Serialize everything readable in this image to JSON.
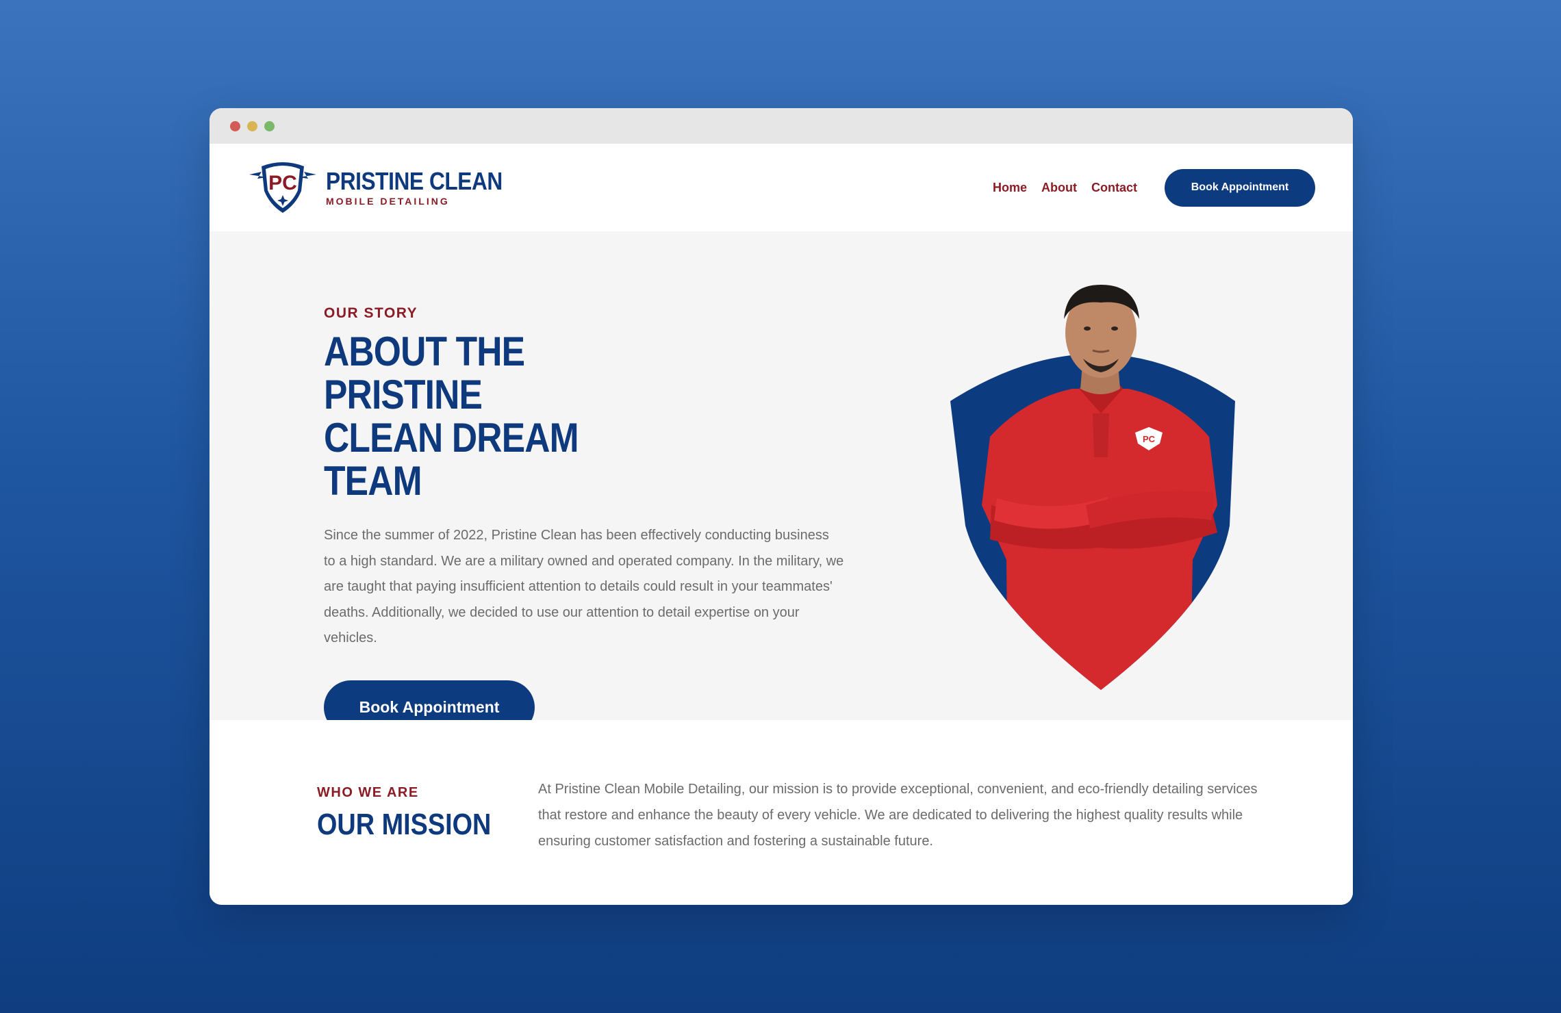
{
  "window": {
    "controls": [
      "close",
      "minimize",
      "maximize"
    ]
  },
  "header": {
    "logo_initials": "PC",
    "logo_title": "PRISTINE CLEAN",
    "logo_subtitle": "MOBILE DETAILING",
    "nav": [
      {
        "label": "Home"
      },
      {
        "label": "About"
      },
      {
        "label": "Contact"
      }
    ],
    "cta_label": "Book Appointment"
  },
  "hero": {
    "eyebrow": "OUR STORY",
    "title_line1": "ABOUT THE PRISTINE",
    "title_line2": "CLEAN DREAM TEAM",
    "body": "Since the summer of 2022, Pristine Clean has been effectively conducting business to a high standard. We are a military owned and operated company. In the military, we are taught that paying insufficient attention to details could result in your teammates' deaths. Additionally, we decided to use our attention to detail expertise on your vehicles.",
    "cta_label": "Book Appointment"
  },
  "mission": {
    "eyebrow": "WHO WE ARE",
    "title": "OUR MISSION",
    "body": "At Pristine Clean Mobile Detailing, our mission is to provide exceptional, convenient, and eco-friendly detailing services that restore and enhance the beauty of every vehicle. We are dedicated to delivering the highest quality results while ensuring customer satisfaction and fostering a sustainable future."
  },
  "colors": {
    "brand_navy": "#0c3b80",
    "brand_red": "#8b1b24",
    "shirt_red": "#d42a2e",
    "hero_bg": "#f5f5f5"
  }
}
